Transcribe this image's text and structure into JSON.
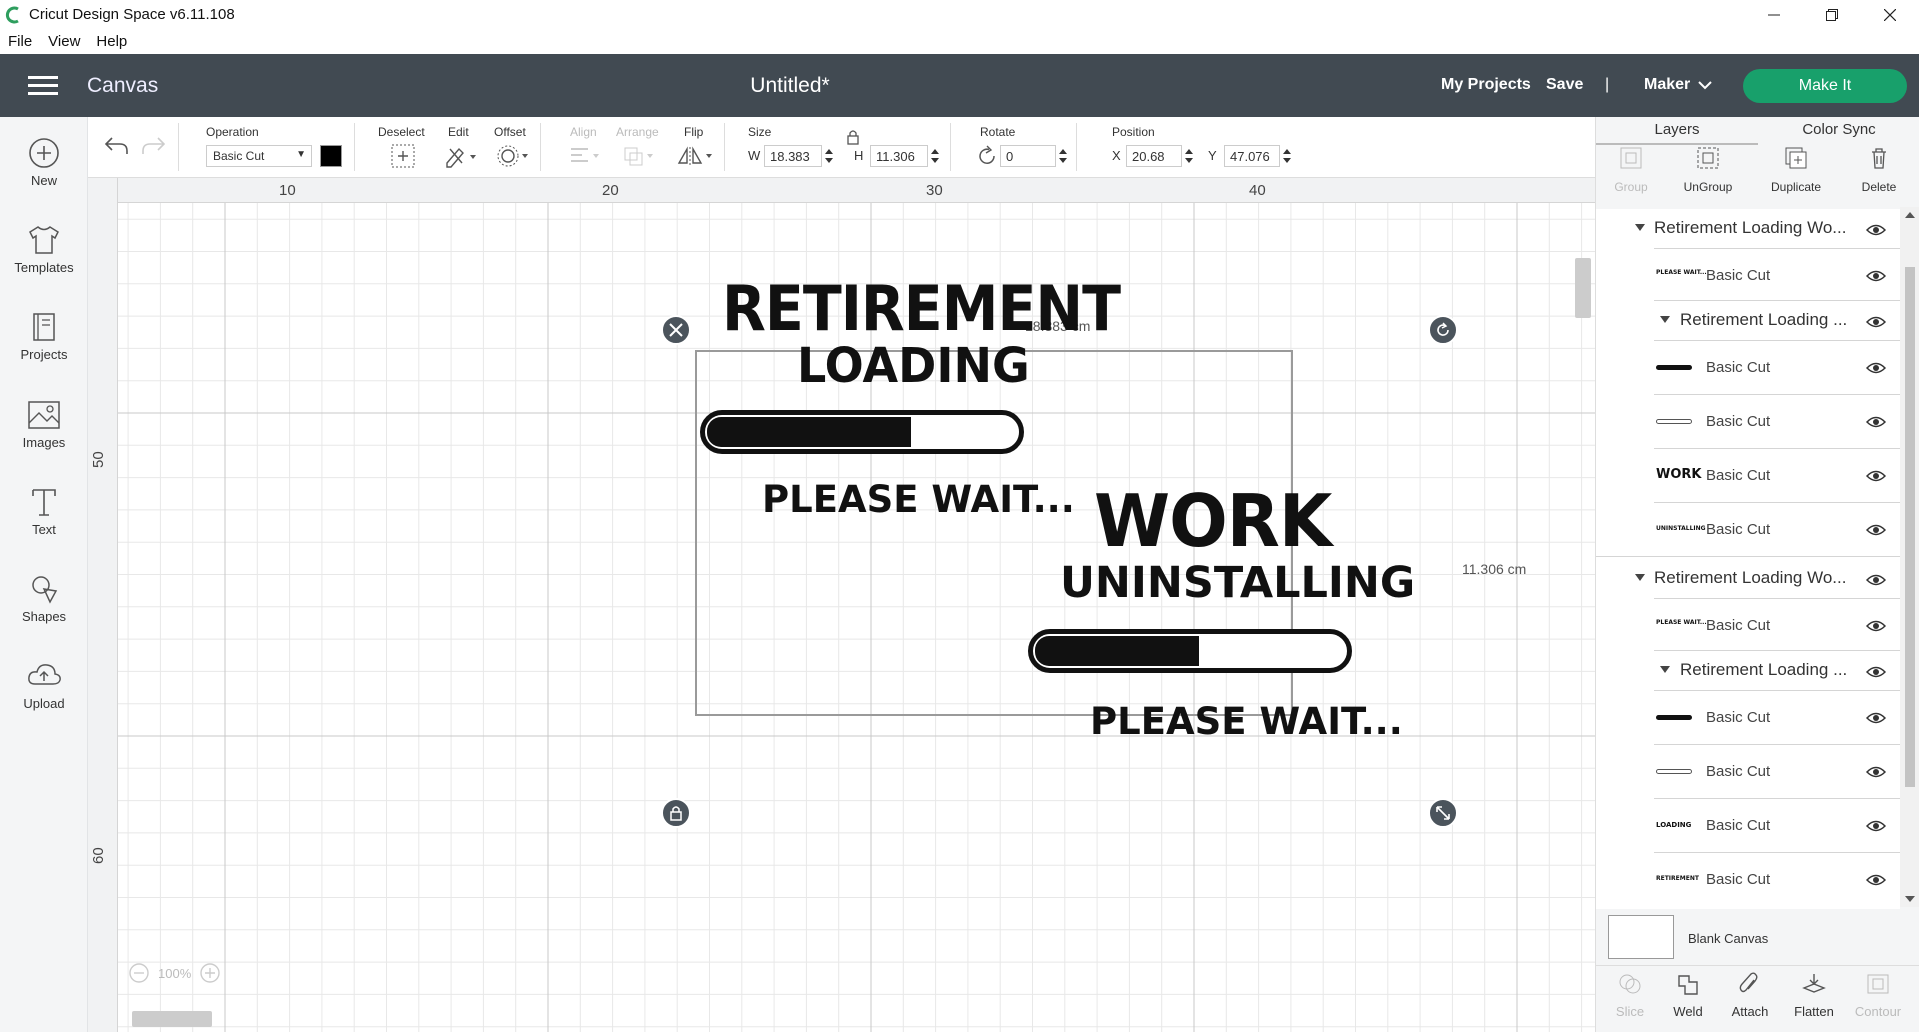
{
  "window": {
    "title": "Cricut Design Space  v6.11.108",
    "controls": [
      "minimize-icon",
      "maximize-icon",
      "close-icon"
    ]
  },
  "menubar": {
    "items": [
      "File",
      "View",
      "Help"
    ]
  },
  "header": {
    "section_title": "Canvas",
    "document_title": "Untitled*",
    "my_projects": "My Projects",
    "save": "Save",
    "divider": "|",
    "machine": "Maker",
    "make_it": "Make It",
    "accent_color": "#18a06b"
  },
  "sidebar": {
    "items": [
      {
        "label": "New",
        "icon": "plus-circle-icon"
      },
      {
        "label": "Templates",
        "icon": "tshirt-icon"
      },
      {
        "label": "Projects",
        "icon": "projects-icon"
      },
      {
        "label": "Images",
        "icon": "image-icon"
      },
      {
        "label": "Text",
        "icon": "text-icon"
      },
      {
        "label": "Shapes",
        "icon": "shapes-icon"
      },
      {
        "label": "Upload",
        "icon": "upload-cloud-icon"
      }
    ]
  },
  "toolbar": {
    "operation_label": "Operation",
    "operation_value": "Basic Cut",
    "deselect": "Deselect",
    "edit": "Edit",
    "offset": "Offset",
    "align": "Align",
    "arrange": "Arrange",
    "flip": "Flip",
    "size_label": "Size",
    "w_label": "W",
    "w_value": "18.383",
    "h_label": "H",
    "h_value": "11.306",
    "rotate_label": "Rotate",
    "rotate_value": "0",
    "position_label": "Position",
    "x_label": "X",
    "x_value": "20.68",
    "y_label": "Y",
    "y_value": "47.076"
  },
  "canvas": {
    "ruler_top": [
      "10",
      "20",
      "30",
      "40"
    ],
    "ruler_left": [
      "50",
      "60"
    ],
    "width_dim": "18.383 cm",
    "height_dim": "11.306 cm",
    "zoom": "100%",
    "design": {
      "line1": "RETIREMENT",
      "line2": "LOADING",
      "line3": "PLEASE WAIT...",
      "line4": "WORK",
      "line5": "UNINSTALLING",
      "line6": "PLEASE WAIT..."
    }
  },
  "layers_panel": {
    "tabs": [
      "Layers",
      "Color Sync"
    ],
    "actions": [
      {
        "label": "Group",
        "enabled": false
      },
      {
        "label": "UnGroup",
        "enabled": true
      },
      {
        "label": "Duplicate",
        "enabled": true
      },
      {
        "label": "Delete",
        "enabled": true
      }
    ],
    "groups": [
      "Retirement Loading Wo...",
      "Retirement Loading ...",
      "Retirement Loading Wo...",
      "Retirement Loading ..."
    ],
    "cut_label": "Basic Cut",
    "thumbs": {
      "please_wait": "PLEASE WAIT...",
      "work": "WORK",
      "uninstalling": "UNINSTALLING",
      "loading": "LOADING",
      "retirement": "RETIREMENT"
    },
    "blank_canvas": "Blank Canvas",
    "bottom_actions": [
      {
        "label": "Slice",
        "enabled": false
      },
      {
        "label": "Weld",
        "enabled": true
      },
      {
        "label": "Attach",
        "enabled": true
      },
      {
        "label": "Flatten",
        "enabled": true
      },
      {
        "label": "Contour",
        "enabled": false
      }
    ]
  }
}
